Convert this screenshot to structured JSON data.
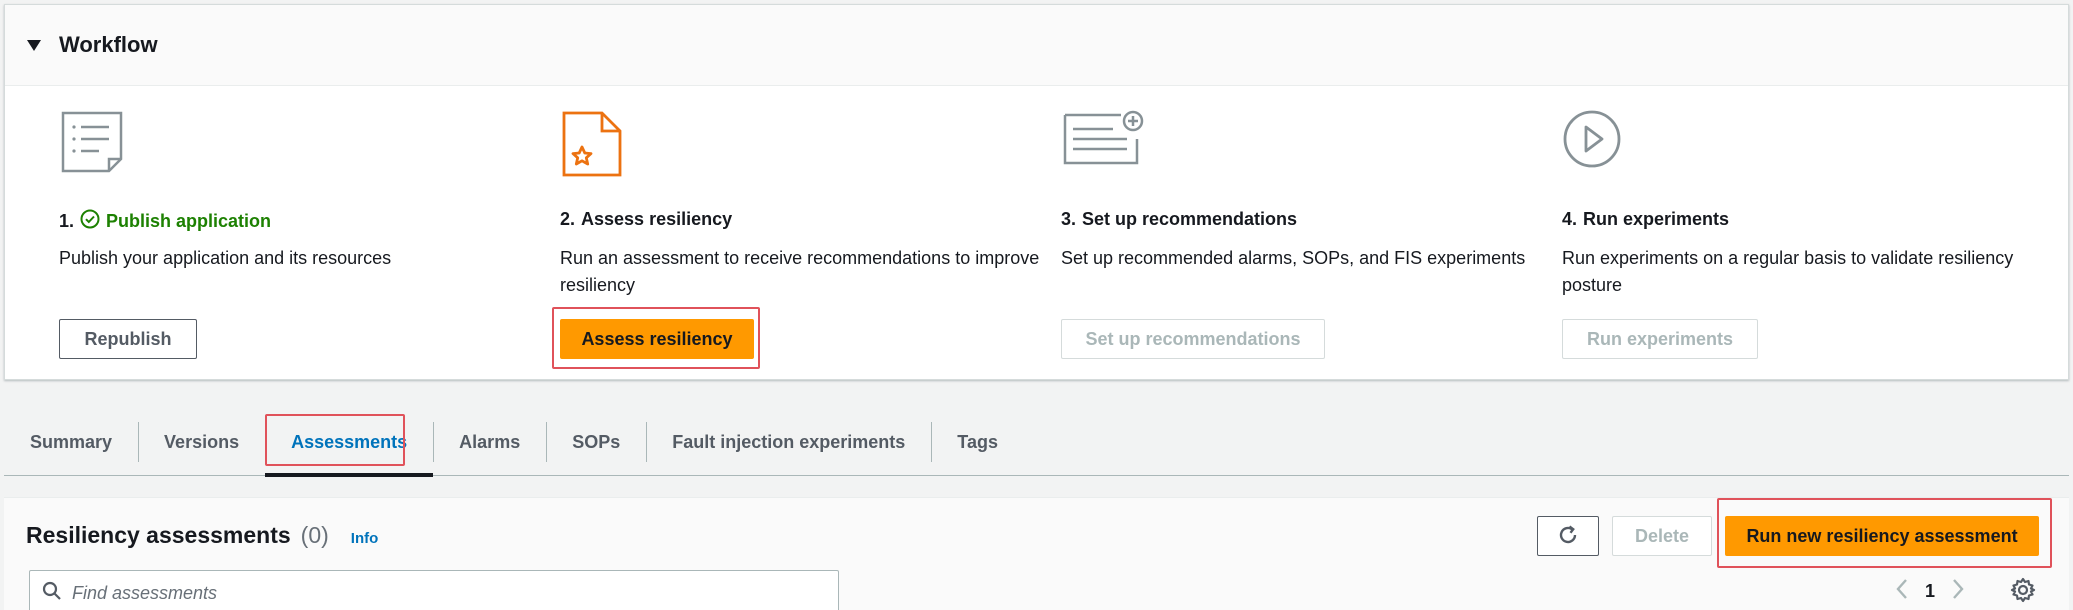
{
  "workflow": {
    "title": "Workflow",
    "steps": [
      {
        "number": "1.",
        "title": "Publish application",
        "status": "completed",
        "description": "Publish your application and its resources",
        "button": "Republish",
        "icon": "list-document-icon"
      },
      {
        "number": "2.",
        "title": "Assess resiliency",
        "description_lines": [
          "Run an assessment to receive recommendations to improve",
          "resiliency"
        ],
        "button": "Assess resiliency",
        "icon": "document-star-icon"
      },
      {
        "number": "3.",
        "title": "Set up recommendations",
        "description": "Set up recommended alarms, SOPs, and FIS experiments",
        "button": "Set up recommendations",
        "icon": "document-plus-icon"
      },
      {
        "number": "4.",
        "title": "Run experiments",
        "description_lines": [
          "Run experiments on a regular basis to validate resiliency",
          "posture"
        ],
        "button": "Run experiments",
        "icon": "play-circle-icon"
      }
    ]
  },
  "tabs": [
    {
      "label": "Summary"
    },
    {
      "label": "Versions"
    },
    {
      "label": "Assessments",
      "active": true
    },
    {
      "label": "Alarms"
    },
    {
      "label": "SOPs"
    },
    {
      "label": "Fault injection experiments"
    },
    {
      "label": "Tags"
    }
  ],
  "assessments": {
    "title": "Resiliency assessments",
    "count": "(0)",
    "info": "Info",
    "delete_label": "Delete",
    "run_label": "Run new resiliency assessment",
    "search_placeholder": "Find assessments",
    "page": "1"
  },
  "colors": {
    "primary": "#ff9900",
    "success": "#1d8102",
    "link": "#0073bb",
    "highlight": "#e0525a",
    "step_icon_orange": "#ec7211",
    "step_icon_gray": "#879196"
  }
}
